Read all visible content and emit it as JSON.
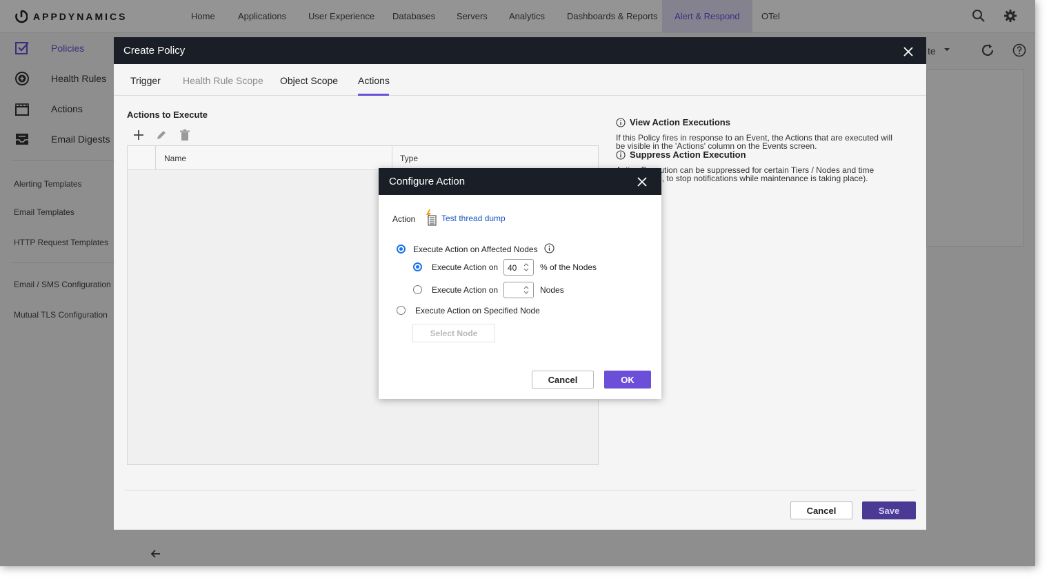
{
  "brand": "APPDYNAMICS",
  "nav": {
    "items": [
      "Home",
      "Applications",
      "User Experience",
      "Databases",
      "Servers",
      "Analytics",
      "Dashboards & Reports",
      "Alert & Respond",
      "OTel"
    ],
    "active": "Alert & Respond"
  },
  "sidebar": {
    "main": [
      {
        "label": "Policies",
        "icon": "checkbox-icon"
      },
      {
        "label": "Health Rules",
        "icon": "plus-circle-icon"
      },
      {
        "label": "Actions",
        "icon": "clapperboard-icon"
      },
      {
        "label": "Email Digests",
        "icon": "inbox-icon"
      }
    ],
    "templates": [
      "Alerting Templates",
      "Email Templates",
      "HTTP Request Templates"
    ],
    "config": [
      "Email / SMS Configuration",
      "Mutual TLS Configuration"
    ]
  },
  "background": {
    "partial_label": "te"
  },
  "policy_modal": {
    "title": "Create Policy",
    "tabs": [
      "Trigger",
      "Health Rule Scope",
      "Object Scope",
      "Actions"
    ],
    "active_tab": "Actions",
    "actions_title": "Actions to Execute",
    "columns": [
      "Name",
      "Type"
    ],
    "info": {
      "view_title": "View Action Executions",
      "view_text_1": "If this Policy fires in response to an Event, the Actions that are executed will",
      "view_text_2": "be visible in the 'Actions' column on the Events screen.",
      "suppress_title": "Suppress Action Execution",
      "suppress_text_1": "Action Execution can be suppressed for certain Tiers / Nodes and time",
      "suppress_text_2": "(for example, to stop notifications while maintenance is taking place)."
    },
    "cancel_label": "Cancel",
    "save_label": "Save"
  },
  "configure_dialog": {
    "title": "Configure Action",
    "action_label": "Action",
    "action_name": "Test thread dump",
    "option_affected": "Execute Action on Affected Nodes",
    "sub_option_label": "Execute Action on",
    "percent_value": "40",
    "percent_suffix": "% of the Nodes",
    "count_value": "",
    "count_suffix": "Nodes",
    "option_specified": "Execute Action on Specified Node",
    "select_node_label": "Select Node",
    "cancel_label": "Cancel",
    "ok_label": "OK",
    "selected": {
      "scope": "affected",
      "mode": "percent"
    }
  },
  "colors": {
    "accent": "#6b4fd8",
    "header_dark": "#1a1f27",
    "radio_blue": "#1a73e8",
    "link_blue": "#1558c0"
  }
}
